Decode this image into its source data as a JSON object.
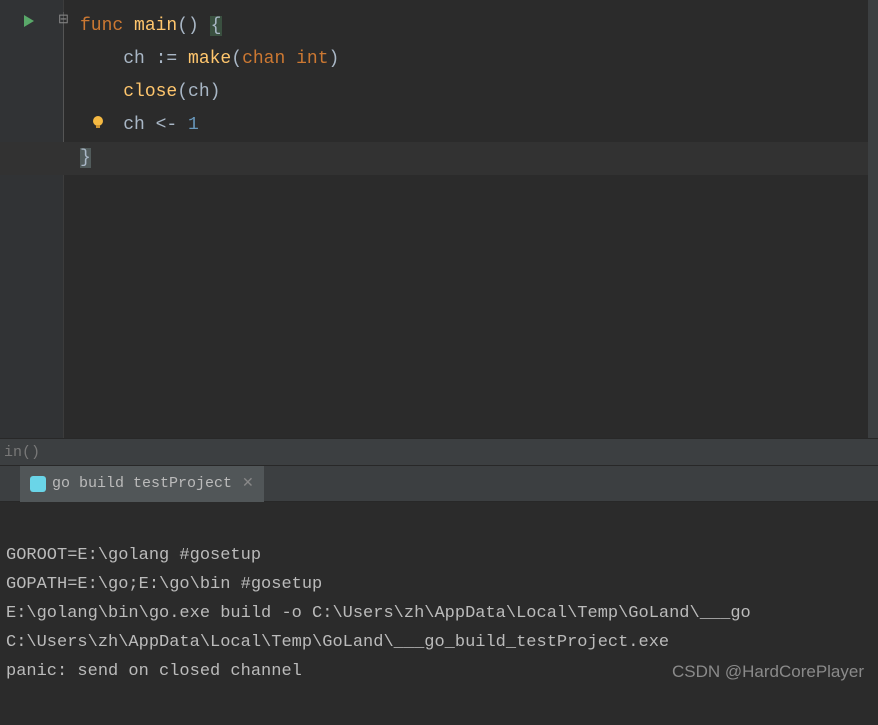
{
  "editor": {
    "lines": {
      "l1_func": "func",
      "l1_name": "main",
      "l1_paren": "() ",
      "l1_brace": "{",
      "l2_indent": "    ",
      "l2_ident": "ch ",
      "l2_assign": ":= ",
      "l2_make": "make",
      "l2_open": "(",
      "l2_chan": "chan",
      "l2_sp": " ",
      "l2_int": "int",
      "l2_close": ")",
      "l3_indent": "    ",
      "l3_close": "close",
      "l3_open": "(",
      "l3_arg": "ch",
      "l3_closep": ")",
      "l4_indent": "    ",
      "l4_ch": "ch ",
      "l4_op": "<- ",
      "l4_num": "1",
      "l5_brace": "}"
    }
  },
  "breadcrumb": {
    "text": "in()"
  },
  "terminal": {
    "tab_label": "go build testProject",
    "output": {
      "l1": "GOROOT=E:\\golang #gosetup",
      "l2": "GOPATH=E:\\go;E:\\go\\bin #gosetup",
      "l3": "E:\\golang\\bin\\go.exe build -o C:\\Users\\zh\\AppData\\Local\\Temp\\GoLand\\___go",
      "l4": "C:\\Users\\zh\\AppData\\Local\\Temp\\GoLand\\___go_build_testProject.exe",
      "l5": "panic: send on closed channel"
    }
  },
  "watermark": "CSDN @HardCorePlayer"
}
